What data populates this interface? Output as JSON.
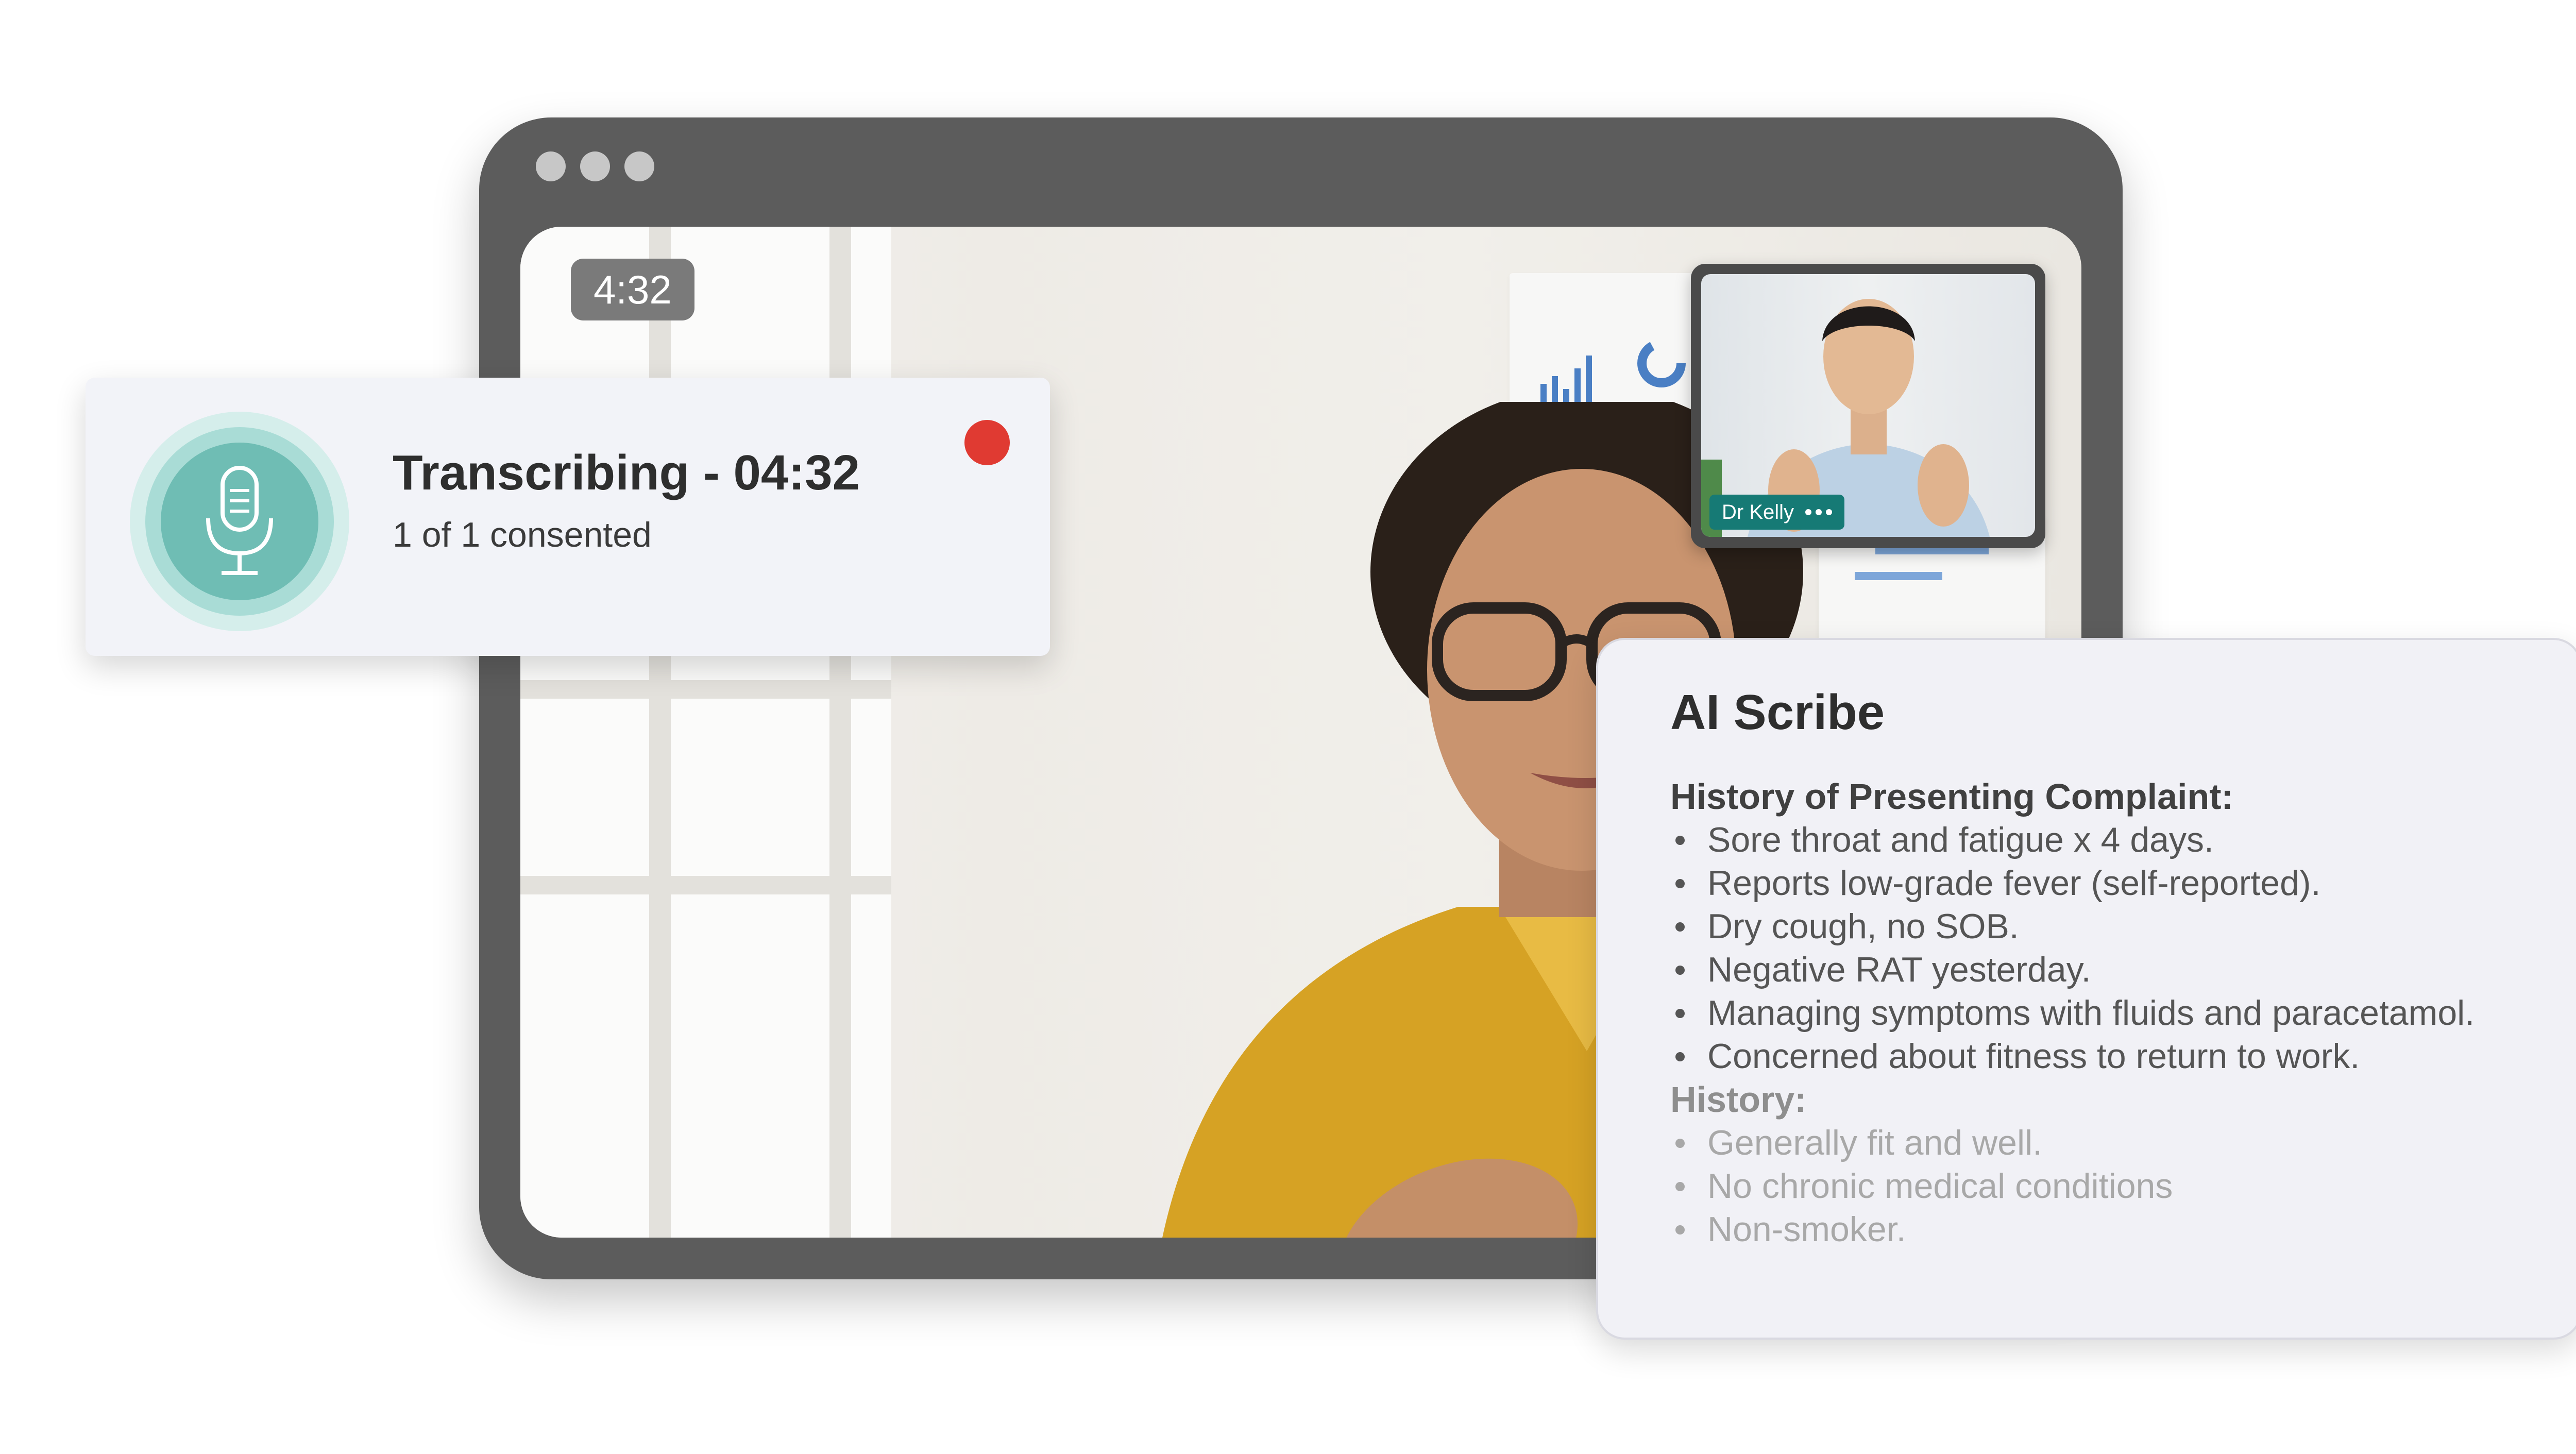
{
  "video": {
    "timer": "4:32",
    "pip_name": "Dr Kelly",
    "more_icon": "more-horizontal-icon"
  },
  "transcribing": {
    "title": "Transcribing - 04:32",
    "subtitle": "1 of 1 consented",
    "mic_icon": "microphone-icon",
    "recording_color": "#e03a32",
    "mic_color": "#6fbdb4"
  },
  "scribe": {
    "title": "AI Scribe",
    "sections": [
      {
        "heading": "History of Presenting Complaint:",
        "items": [
          "Sore throat and fatigue x 4 days.",
          "Reports low-grade fever (self-reported).",
          "Dry cough, no SOB.",
          "Negative RAT yesterday.",
          "Managing symptoms with fluids and paracetamol.",
          "Concerned about fitness to return to work."
        ]
      },
      {
        "heading": "History:",
        "items": [
          "Generally fit and well.",
          "No chronic medical conditions",
          "Non-smoker."
        ]
      }
    ]
  },
  "colors": {
    "frame": "#5c5c5c",
    "pip_label": "#167a75",
    "card_bg": "#f2f3f8"
  }
}
